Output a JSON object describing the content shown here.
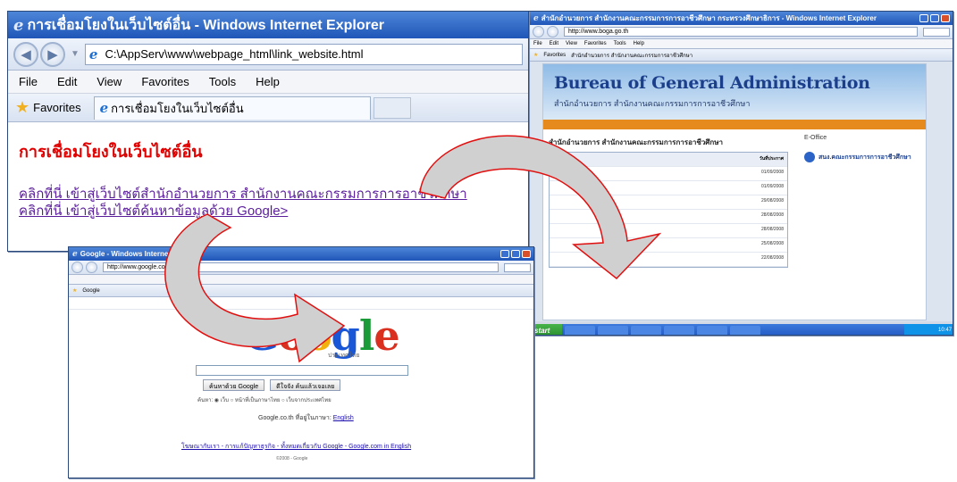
{
  "window_link": {
    "title": "การเชื่อมโยงในเว็บไซต์อื่น - Windows Internet Explorer",
    "address": "C:\\AppServ\\www\\webpage_html\\link_website.html",
    "menu": [
      "File",
      "Edit",
      "View",
      "Favorites",
      "Tools",
      "Help"
    ],
    "favorites_label": "Favorites",
    "tab_title": "การเชื่อมโยงในเว็บไซต์อื่น",
    "heading": "การเชื่อมโยงในเว็บไซต์อื่น",
    "link1": "คลิกที่นี่ เข้าสู่เว็บไซต์สำนักอำนวยการ สำนักงานคณะกรรมการการอาชีวศึกษา",
    "link2": "คลิกที่นี่ เข้าสู่เว็บไซต์ค้นหาข้อมูลด้วย Google>"
  },
  "window_boga": {
    "title": "สำนักอำนวยการ สำนักงานคณะกรรมการการอาชีวศึกษา กระทรวงศึกษาธิการ - Windows Internet Explorer",
    "address": "http://www.boga.go.th",
    "menu": [
      "File",
      "Edit",
      "View",
      "Favorites",
      "Tools",
      "Help"
    ],
    "favorites_label": "Favorites",
    "tab_title": "สำนักอำนวยการ สำนักงานคณะกรรมการอาชีวศึกษา",
    "banner_title": "Bureau of General Administration",
    "banner_sub": "สำนักอำนวยการ สำนักงานคณะกรรมการการอาชีวศึกษา",
    "agency_title": "สำนักอำนวยการ สำนักงานคณะกรรมการการอาชีวศึกษา",
    "date_header": "วันที่ประกาศ",
    "news_dates": [
      "01/09/2008",
      "01/09/2008",
      "29/08/2008",
      "28/08/2008",
      "28/08/2008",
      "25/08/2008",
      "22/08/2008"
    ],
    "right_eoffice": "E-Office",
    "omb_text": "สนง.คณะกรรมการการอาชีวศึกษา",
    "taskbar_start": "start",
    "tray_time": "10:47"
  },
  "window_google": {
    "title": "Google - Windows Internet Explorer",
    "address": "http://www.google.co.th",
    "tab_title": "Google",
    "logo": [
      "G",
      "o",
      "o",
      "g",
      "l",
      "e"
    ],
    "logo_sub": "ประเทศไทย",
    "search_btn": "ค้นหาด้วย Google",
    "lucky_btn": "ดีใจจัง ค้นแล้วเจอเลย",
    "radio": "ค้นหา: ◉ เว็บ ○ หน้าที่เป็นภาษาไทย ○ เว็บจากประเทศไทย",
    "footer_offered": "Google.co.th ที่อยู่ในภาษา:",
    "footer_english": "English",
    "footer_links": "โฆษณากับเรา - การแก้ปัญหาธุรกิจ - ทั้งหมดเกี่ยวกับ Google - Google.com in English",
    "footer_copy": "©2008 - Google"
  }
}
